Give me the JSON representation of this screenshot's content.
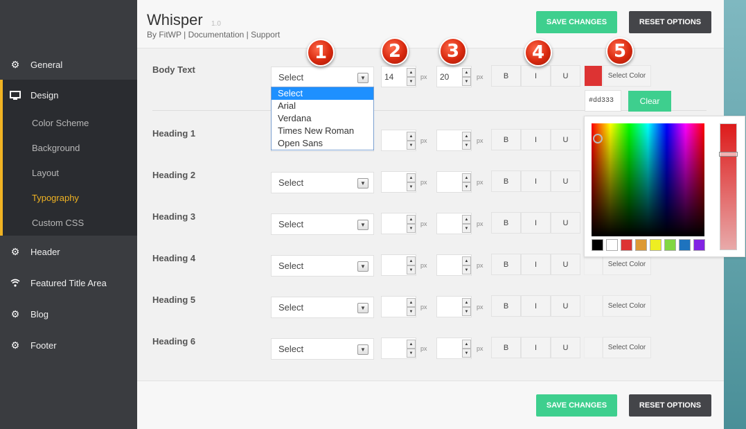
{
  "sidebar": {
    "items": [
      {
        "label": "General",
        "icon": "gear-icon"
      },
      {
        "label": "Design",
        "icon": "monitor-icon"
      },
      {
        "label": "Header",
        "icon": "gear-icon"
      },
      {
        "label": "Featured Title Area",
        "icon": "wifi-icon"
      },
      {
        "label": "Blog",
        "icon": "gear-icon"
      },
      {
        "label": "Footer",
        "icon": "gear-icon"
      }
    ],
    "submenu": [
      "Color Scheme",
      "Background",
      "Layout",
      "Typography",
      "Custom CSS"
    ],
    "active_sub": "Typography"
  },
  "header": {
    "title": "Whisper",
    "version": "1.0",
    "by": "By FitWP",
    "sep": "|",
    "documentation": "Documentation",
    "support": "Support"
  },
  "buttons": {
    "save": "SAVE CHANGES",
    "reset": "RESET OPTIONS",
    "clear": "Clear",
    "select_color": "Select Color"
  },
  "typography": {
    "unit": "px",
    "format_labels": [
      "B",
      "I",
      "U"
    ],
    "rows": [
      {
        "label": "Body Text",
        "font": "Select",
        "size": "14",
        "line_height": "20",
        "color": "#dd3333"
      },
      {
        "label": "Heading 1",
        "font": "Select",
        "size": "",
        "line_height": "",
        "color": ""
      },
      {
        "label": "Heading 2",
        "font": "Select",
        "size": "",
        "line_height": "",
        "color": ""
      },
      {
        "label": "Heading 3",
        "font": "Select",
        "size": "",
        "line_height": "",
        "color": ""
      },
      {
        "label": "Heading 4",
        "font": "Select",
        "size": "",
        "line_height": "",
        "color": ""
      },
      {
        "label": "Heading 5",
        "font": "Select",
        "size": "",
        "line_height": "",
        "color": ""
      },
      {
        "label": "Heading 6",
        "font": "Select",
        "size": "",
        "line_height": "",
        "color": ""
      }
    ]
  },
  "font_dropdown": {
    "options": [
      "Select",
      "Arial",
      "Verdana",
      "Times New Roman",
      "Open Sans"
    ],
    "selected": "Select"
  },
  "color_picker": {
    "hex_value": "#dd333",
    "current": "#dd3333",
    "palette": [
      "#000000",
      "#ffffff",
      "#dd3333",
      "#dd9933",
      "#eeee22",
      "#81d742",
      "#1e73be",
      "#8224e3"
    ]
  },
  "annotations": [
    "1",
    "2",
    "3",
    "4",
    "5"
  ],
  "colors": {
    "accent": "#3ecf8e",
    "sidebar_bg": "#3a3c40",
    "highlight": "#f0b323",
    "reset_bg": "#444549"
  }
}
